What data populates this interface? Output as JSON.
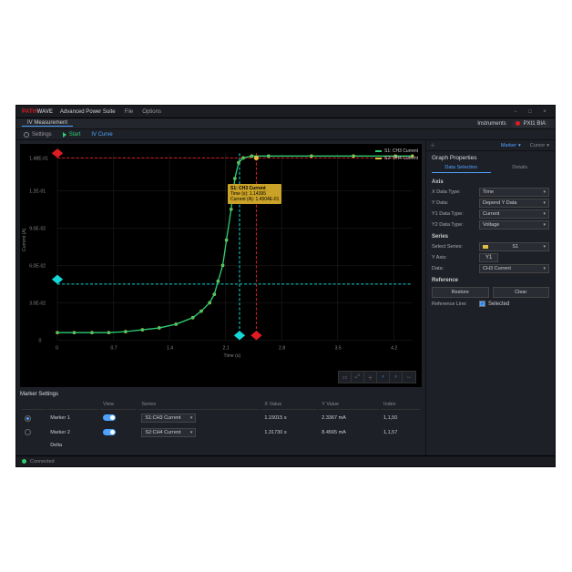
{
  "titlebar": {
    "brand": "PATH",
    "brand2": "WAVE",
    "app": "Advanced Power Suite",
    "menu_file": "File",
    "menu_options": "Options"
  },
  "subbar": {
    "tab": "IV Measurement",
    "instr_label": "Instruments",
    "instr_chip": "PXI1 BIA"
  },
  "toolbar": {
    "settings": "Settings",
    "start": "Start",
    "ivcurve": "IV Curve"
  },
  "chart": {
    "xlabel": "Time (s)",
    "ylabel": "Current (A)"
  },
  "legend": {
    "s1_label": "S1: CH3 Current",
    "s2_label": "S2: CH4 Current",
    "s1_color": "#2ecc71",
    "s2_color": "#e0c040"
  },
  "tooltip": {
    "l1": "S1: CH3 Current",
    "l2": "Time (s):  1.14395",
    "l3": "Current (A):  1.4504E-01"
  },
  "marker_section": {
    "title": "Marker Settings",
    "delta": "Delta",
    "cols": {
      "blank": "",
      "name": "",
      "view": "View",
      "series": "Series",
      "x": "X Value",
      "y": "Y Value",
      "index": "Index"
    },
    "rows": [
      {
        "name": "Marker 1",
        "selected": true,
        "view": true,
        "series": "S1:CH3 Current",
        "x": "1.15015 s",
        "y": "2.3367 mA",
        "index": "1,1,50"
      },
      {
        "name": "Marker 2",
        "selected": false,
        "view": true,
        "series": "S2:CH4 Current",
        "x": "1.31730 s",
        "y": "8.4565 mA",
        "index": "1,1,57"
      }
    ]
  },
  "right_tabbar": {
    "marker": "Marker",
    "cursor": "Cursor"
  },
  "graph_props": {
    "title": "Graph Properties",
    "tab_data": "Data Selection",
    "tab_details": "Details"
  },
  "axis_group": {
    "title": "Axis",
    "x_label": "X Data Type:",
    "x_value": "Time",
    "y_label": "Y Data:",
    "y_value": "Depend Y Data",
    "y1_label": "Y1 Data Type:",
    "y1_value": "Current",
    "y2_label": "Y2 Data Type:",
    "y2_value": "Voltage"
  },
  "series_group": {
    "title": "Series",
    "select_label": "Select Series:",
    "select_value": "S1",
    "yaxis_label": "Y Axis:",
    "yaxis_value": "Y1",
    "data_label": "Data:",
    "data_value": "CH3 Current"
  },
  "ref_group": {
    "title": "Reference",
    "restore": "Restore",
    "clear": "Clear",
    "refline_label": "Reference Line:",
    "refline_value": "Selected",
    "refline_checked": true
  },
  "status": {
    "text": "Connected"
  },
  "chart_data": {
    "type": "line",
    "xlabel": "Time (s)",
    "ylabel": "Current (A)",
    "xlim": [
      0,
      4.2
    ],
    "ylim": [
      0,
      0.15
    ],
    "x": [
      0.0,
      0.2,
      0.4,
      0.6,
      0.8,
      1.0,
      1.2,
      1.4,
      1.6,
      1.7,
      1.8,
      1.85,
      1.9,
      1.95,
      2.0,
      2.05,
      2.1,
      2.15,
      2.2,
      2.3,
      2.5,
      3.0,
      3.5,
      4.0,
      4.2
    ],
    "series": [
      {
        "name": "S1: CH3 Current",
        "color": "#2ecc71",
        "values": [
          0.006,
          0.006,
          0.006,
          0.006,
          0.007,
          0.008,
          0.01,
          0.013,
          0.018,
          0.023,
          0.03,
          0.037,
          0.047,
          0.06,
          0.08,
          0.105,
          0.13,
          0.142,
          0.146,
          0.148,
          0.148,
          0.148,
          0.148,
          0.148,
          0.148
        ]
      },
      {
        "name": "S2: CH4 Current",
        "color": "#e0c040",
        "values": [
          0.006,
          0.006,
          0.006,
          0.006,
          0.007,
          0.008,
          0.01,
          0.013,
          0.018,
          0.023,
          0.03,
          0.037,
          0.047,
          0.06,
          0.08,
          0.105,
          0.13,
          0.142,
          0.146,
          0.148,
          0.148,
          0.148,
          0.148,
          0.148,
          0.148
        ]
      }
    ],
    "markers": [
      {
        "label": "M1",
        "color": "#e01b24",
        "shape": "diamond",
        "x": 0.1,
        "y": 0.146
      },
      {
        "label": "M2",
        "color": "#16d6d6",
        "shape": "diamond",
        "x": 0.1,
        "y": 0.045
      },
      {
        "label": "M1x",
        "color": "#e01b24",
        "shape": "diamond",
        "x": 2.35,
        "y": 0.003
      },
      {
        "label": "M2x",
        "color": "#16d6d6",
        "shape": "diamond",
        "x": 2.15,
        "y": 0.003
      }
    ]
  }
}
